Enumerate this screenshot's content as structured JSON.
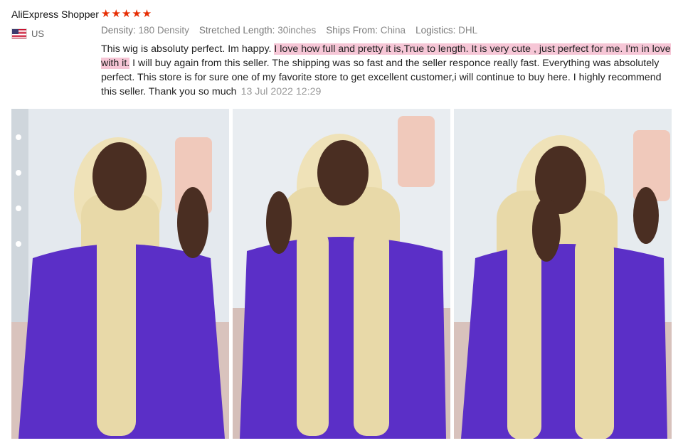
{
  "review": {
    "reviewer_name": "AliExpress Shopper",
    "stars": "★★★★★",
    "rating": 5,
    "country_code": "US",
    "attributes": [
      {
        "label": "Density:",
        "value": "180 Density"
      },
      {
        "label": "Stretched Length:",
        "value": "30inches"
      },
      {
        "label": "Ships From:",
        "value": "China"
      },
      {
        "label": "Logistics:",
        "value": "DHL"
      }
    ],
    "text_part1": "This wig is absoluty perfect. Im happy. ",
    "text_highlight": "I love how full and pretty it is,True to length. It is very cute , just perfect for me. I'm in love with it.",
    "text_part2": " I will buy again from this seller. The shipping was so fast and the seller responce really fast. Everything was absolutely perfect. This store is for sure one of my favorite store to get excellent customer,i will continue to buy here. I highly recommend this seller. Thank you so much",
    "date": "13 Jul 2022 12:29"
  },
  "colors": {
    "star": "#e62e04",
    "highlight": "#f6c6d6",
    "outfit": "#5b2fc7",
    "hair": "#e8d9a8"
  },
  "photos": [
    {
      "icon": "review-photo"
    },
    {
      "icon": "review-photo"
    },
    {
      "icon": "review-photo"
    }
  ]
}
